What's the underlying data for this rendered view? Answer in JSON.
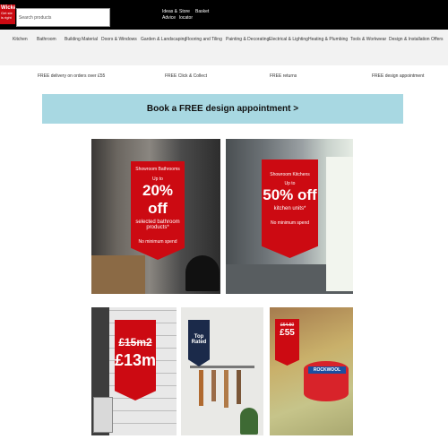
{
  "header": {
    "logo_top": "Wickes",
    "logo_sub": "Get ste is right",
    "search_placeholder": "Search products",
    "util": [
      {
        "label": "Ideas &\nAdvice"
      },
      {
        "label": "Store\nlocator"
      },
      {
        "label": "Basket"
      }
    ]
  },
  "nav": {
    "items": [
      "Kitchen",
      "Bathroom",
      "Building Material",
      "Doors & Windows",
      "Garden & Landscaping",
      "Flooring and Tiling",
      "Painting & Decorating",
      "Electrical & Lighting",
      "Heating & Plumbing",
      "Tools & Workwear",
      "Design & Installation",
      "Offers"
    ]
  },
  "usps": [
    "FREE delivery on orders over £55",
    "FREE Click & Collect",
    "FREE returns",
    "FREE design appointment"
  ],
  "banner": {
    "label": "Book a FREE design appointment >"
  },
  "promos": {
    "bathrooms": {
      "line1": "Showroom Bathrooms",
      "line2": "Up to",
      "big": "20% off",
      "line3": "selected bathroom products*",
      "line4": "No minimum spend"
    },
    "kitchens": {
      "line1": "Showroom Kitchens",
      "line2": "Up to",
      "big": "50% off",
      "line3": "kitchen units*",
      "line4": "No minimum spend"
    },
    "tiles": {
      "old_price": "£15m2",
      "new_price": "£13m2"
    },
    "toprated": {
      "label": "Top Rated"
    },
    "insulation": {
      "old_price": "£64.50",
      "new_price": "£55",
      "brand": "ROCKWOOL"
    }
  }
}
